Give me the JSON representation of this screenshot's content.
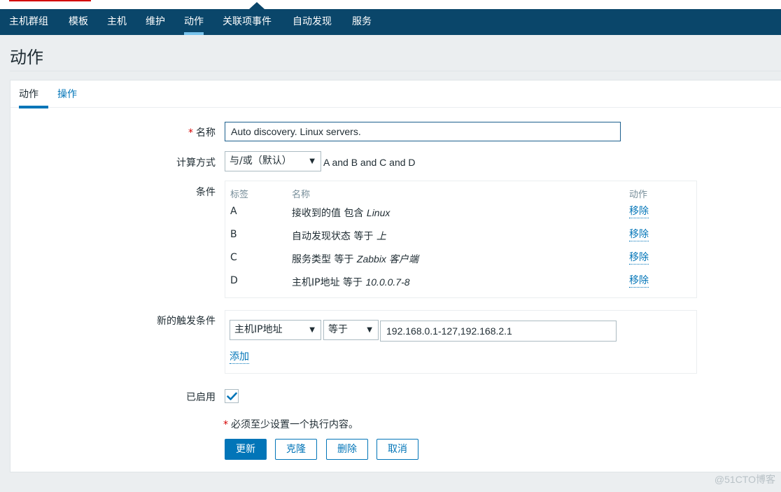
{
  "nav": {
    "items": [
      {
        "label": "主机群组",
        "active": false
      },
      {
        "label": "模板",
        "active": false
      },
      {
        "label": "主机",
        "active": false
      },
      {
        "label": "维护",
        "active": false
      },
      {
        "label": "动作",
        "active": true
      },
      {
        "label": "关联项事件",
        "active": false
      },
      {
        "label": "自动发现",
        "active": false
      },
      {
        "label": "服务",
        "active": false
      }
    ]
  },
  "page": {
    "title": "动作"
  },
  "tabs": [
    {
      "label": "动作",
      "active": true
    },
    {
      "label": "操作",
      "active": false
    }
  ],
  "form": {
    "name": {
      "required_mark": "*",
      "label": "名称",
      "value": "Auto discovery. Linux servers."
    },
    "calc": {
      "label": "计算方式",
      "selected": "与/或（默认）",
      "formula": "A and B and C and D"
    },
    "conditions": {
      "label": "条件",
      "headers": {
        "tag": "标签",
        "name": "名称",
        "action": "动作"
      },
      "rows": [
        {
          "tag": "A",
          "name_prefix": "接收到的值 包含 ",
          "name_value": "Linux",
          "action": "移除"
        },
        {
          "tag": "B",
          "name_prefix": "自动发现状态 等于 ",
          "name_value": "上",
          "action": "移除"
        },
        {
          "tag": "C",
          "name_prefix": "服务类型 等于 ",
          "name_value": "Zabbix 客户端",
          "action": "移除"
        },
        {
          "tag": "D",
          "name_prefix": "主机IP地址 等于 ",
          "name_value": "10.0.0.7-8",
          "action": "移除"
        }
      ]
    },
    "new_condition": {
      "label": "新的触发条件",
      "type_selected": "主机IP地址",
      "operator_selected": "等于",
      "value": "192.168.0.1-127,192.168.2.1",
      "add_label": "添加"
    },
    "enabled": {
      "label": "已启用",
      "checked": true
    },
    "note": {
      "required_mark": "*",
      "text": "必须至少设置一个执行内容。"
    },
    "buttons": {
      "update": "更新",
      "clone": "克隆",
      "delete": "删除",
      "cancel": "取消"
    }
  },
  "watermark": "@51CTO博客",
  "colors": {
    "nav_bg": "#0a466a",
    "accent": "#0275b8",
    "required": "#d40000",
    "page_bg": "#ebeef0"
  }
}
